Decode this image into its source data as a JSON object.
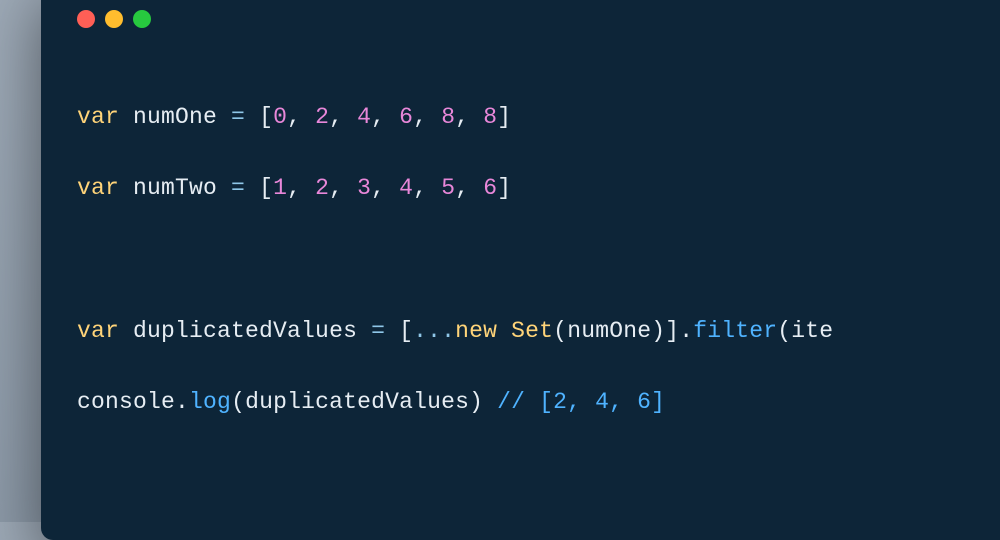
{
  "window": {
    "traffic": {
      "red": "#ff5f56",
      "yellow": "#ffbd2e",
      "green": "#27c93f"
    }
  },
  "code": {
    "line1": {
      "kw": "var",
      "id": "numOne",
      "eq": " = ",
      "lb": "[",
      "v0": "0",
      "c0": ", ",
      "v1": "2",
      "c1": ", ",
      "v2": "4",
      "c2": ", ",
      "v3": "6",
      "c3": ", ",
      "v4": "8",
      "c4": ", ",
      "v5": "8",
      "rb": "]"
    },
    "line2": {
      "kw": "var",
      "id": "numTwo",
      "eq": " = ",
      "lb": "[",
      "v0": "1",
      "c0": ", ",
      "v1": "2",
      "c1": ", ",
      "v2": "3",
      "c2": ", ",
      "v3": "4",
      "c3": ", ",
      "v4": "5",
      "c4": ", ",
      "v5": "6",
      "rb": "]"
    },
    "line3": {
      "kw": "var",
      "id": "duplicatedValues",
      "eq": " = ",
      "lb": "[",
      "spread": "...",
      "new": "new",
      "sp": " ",
      "cls": "Set",
      "lp": "(",
      "arg": "numOne",
      "rp": ")",
      "rb": "]",
      "dot": ".",
      "filter": "filter",
      "lp2": "(",
      "ite": "ite"
    },
    "line4": {
      "console": "console",
      "dot": ".",
      "log": "log",
      "lp": "(",
      "arg": "duplicatedValues",
      "rp": ")",
      "sp": " ",
      "comment": "// [2, 4, 6]"
    }
  }
}
